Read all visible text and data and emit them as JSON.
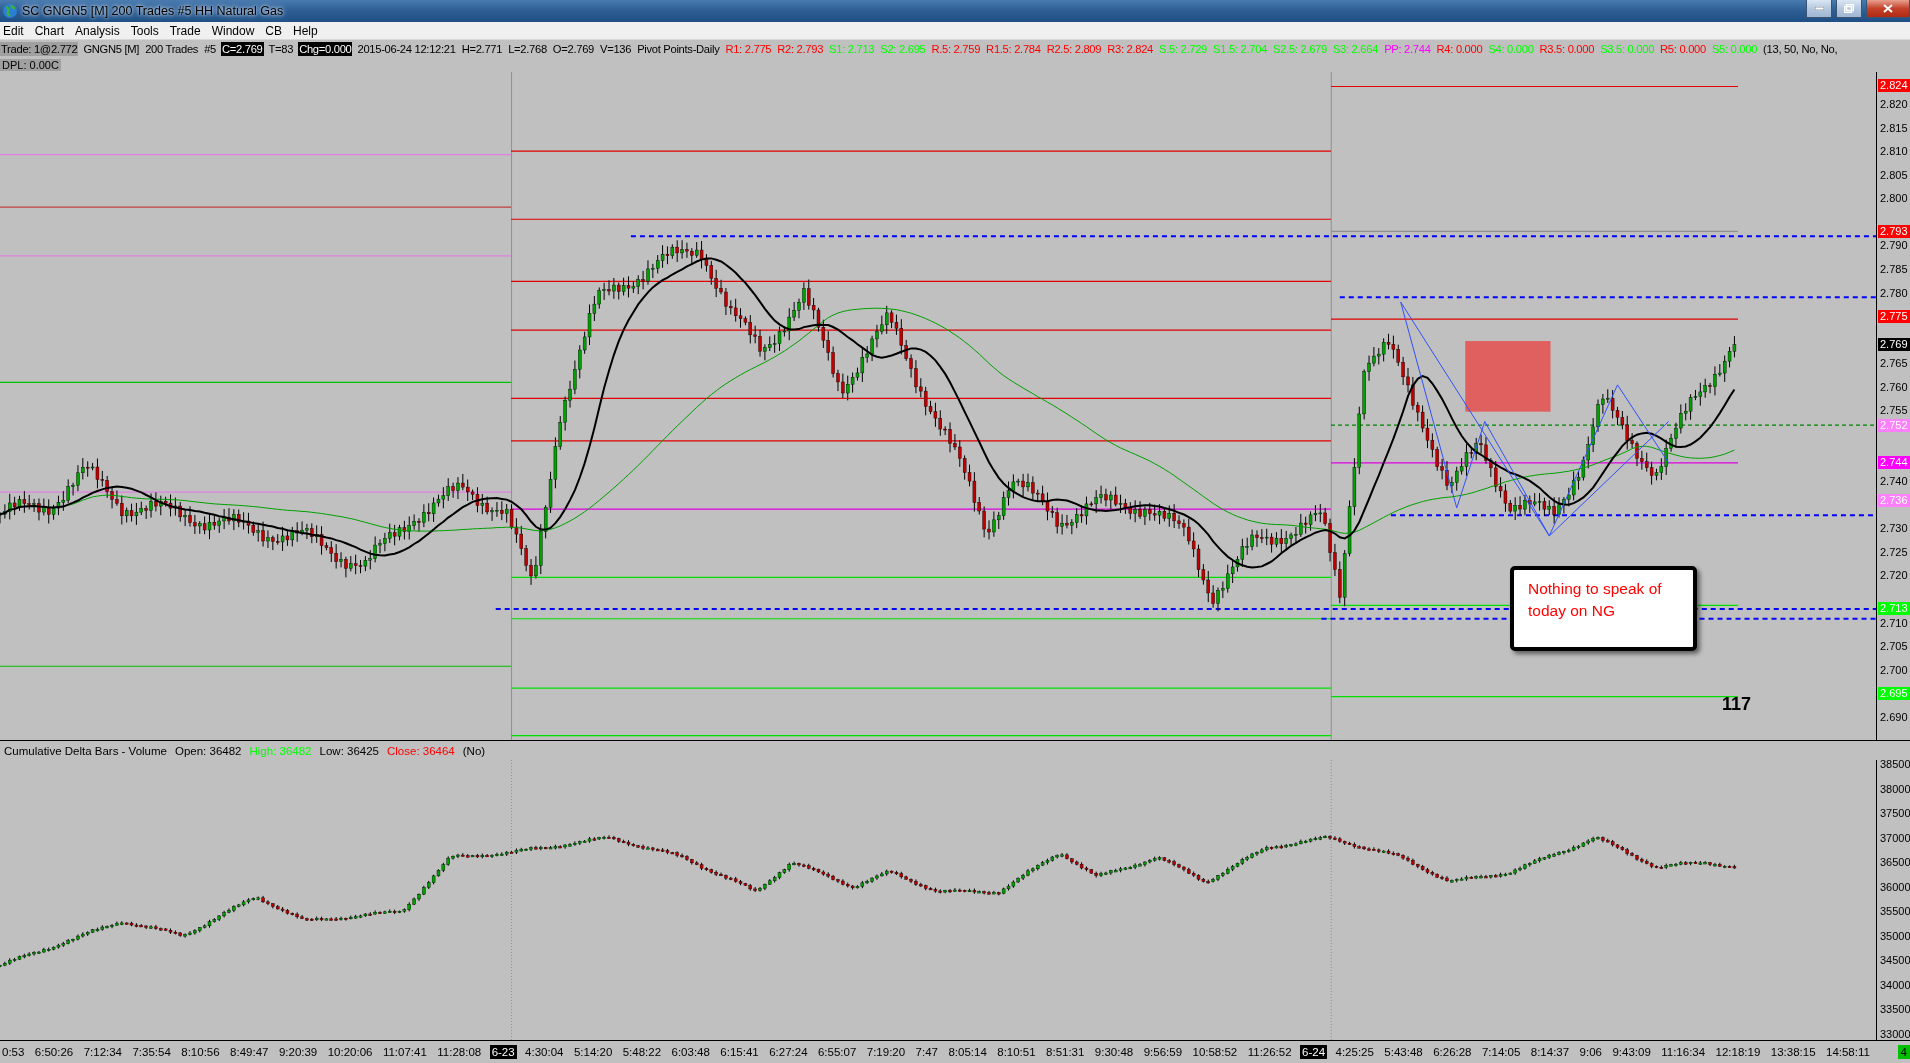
{
  "window": {
    "title": "SC GNGN5 [M]  200 Trades  #5  HH Natural Gas"
  },
  "menu": [
    "Edit",
    "Chart",
    "Analysis",
    "Tools",
    "Trade",
    "Window",
    "CB",
    "Help"
  ],
  "info_bar": [
    {
      "text": "Trade: 1@2.772",
      "kind": "shaded"
    },
    {
      "text": "GNGN5 [M]",
      "kind": "plain"
    },
    {
      "text": "200 Trades",
      "kind": "plain"
    },
    {
      "text": "#5",
      "kind": "plain"
    },
    {
      "text": "C=2.769",
      "kind": "inverse"
    },
    {
      "text": "T=83",
      "kind": "plain"
    },
    {
      "text": "Chg=0.000",
      "kind": "inverse"
    },
    {
      "text": "2015-06-24 12:12:21",
      "kind": "plain"
    },
    {
      "text": "H=2.771",
      "kind": "plain"
    },
    {
      "text": "L=2.768",
      "kind": "plain"
    },
    {
      "text": "O=2.769",
      "kind": "plain"
    },
    {
      "text": "V=136",
      "kind": "plain"
    },
    {
      "text": "Pivot Points-Daily",
      "kind": "plain"
    },
    {
      "text": "R1: 2.775",
      "kind": "plain",
      "color": "#ff0000"
    },
    {
      "text": "R2: 2.793",
      "kind": "plain",
      "color": "#ff0000"
    },
    {
      "text": "S1: 2.713",
      "kind": "plain",
      "color": "#00ff00"
    },
    {
      "text": "S2: 2.695",
      "kind": "plain",
      "color": "#00ff00"
    },
    {
      "text": "R.5: 2.759",
      "kind": "plain",
      "color": "#ff0000"
    },
    {
      "text": "R1.5: 2.784",
      "kind": "plain",
      "color": "#ff0000"
    },
    {
      "text": "R2.5: 2.809",
      "kind": "plain",
      "color": "#ff0000"
    },
    {
      "text": "R3: 2.824",
      "kind": "plain",
      "color": "#ff0000"
    },
    {
      "text": "S.5: 2.729",
      "kind": "plain",
      "color": "#00ff00"
    },
    {
      "text": "S1.5: 2.704",
      "kind": "plain",
      "color": "#00ff00"
    },
    {
      "text": "S2.5: 2.679",
      "kind": "plain",
      "color": "#00ff00"
    },
    {
      "text": "S3: 2.664",
      "kind": "plain",
      "color": "#00ff00"
    },
    {
      "text": "PP: 2.744",
      "kind": "plain",
      "color": "#ff00ff"
    },
    {
      "text": "R4: 0.000",
      "kind": "plain",
      "color": "#ff0000"
    },
    {
      "text": "S4: 0.000",
      "kind": "plain",
      "color": "#00ff00"
    },
    {
      "text": "R3.5: 0.000",
      "kind": "plain",
      "color": "#ff0000"
    },
    {
      "text": "S3.5: 0.000",
      "kind": "plain",
      "color": "#00ff00"
    },
    {
      "text": "R5: 0.000",
      "kind": "plain",
      "color": "#ff0000"
    },
    {
      "text": "S5: 0.000",
      "kind": "plain",
      "color": "#00ff00"
    },
    {
      "text": "(13, 50, No, No,",
      "kind": "plain"
    }
  ],
  "dpl": "DPL: 0.00C",
  "note": "Nothing to speak of today on NG",
  "bar_count": "117",
  "price_axis": {
    "ticks": [
      "2.820",
      "2.815",
      "2.810",
      "2.805",
      "2.800",
      "2.790",
      "2.785",
      "2.780",
      "2.765",
      "2.760",
      "2.755",
      "2.740",
      "2.730",
      "2.725",
      "2.720",
      "2.710",
      "2.705",
      "2.700",
      "2.690"
    ],
    "markers": [
      {
        "text": "2.824",
        "color": "#ff0000"
      },
      {
        "text": "2.793",
        "color": "#ff0000"
      },
      {
        "text": "2.775",
        "color": "#ff0000"
      },
      {
        "text": "2.769",
        "color": "#000000"
      },
      {
        "text": "2.752",
        "color": "#ff80ff"
      },
      {
        "text": "2.744",
        "color": "#ff00ff"
      },
      {
        "text": "2.736",
        "color": "#ff80ff"
      },
      {
        "text": "2.713",
        "color": "#00ff00"
      },
      {
        "text": "2.695",
        "color": "#00ff00"
      }
    ]
  },
  "lower_panel": {
    "header": [
      {
        "text": "Cumulative Delta Bars - Volume"
      },
      {
        "text": "Open: 36482"
      },
      {
        "text": "High: 36482",
        "color": "#00ff00"
      },
      {
        "text": "Low: 36425"
      },
      {
        "text": "Close: 36464",
        "color": "#ff0000"
      },
      {
        "text": "(No)"
      }
    ],
    "ticks": [
      "38500",
      "38000",
      "37500",
      "37000",
      "36500",
      "36000",
      "35500",
      "35000",
      "34500",
      "34000",
      "33500",
      "33000"
    ]
  },
  "time_axis": [
    {
      "text": "0:53",
      "kind": "time"
    },
    {
      "text": "6:50:26",
      "kind": "time"
    },
    {
      "text": "7:12:34",
      "kind": "time"
    },
    {
      "text": "7:35:54",
      "kind": "time"
    },
    {
      "text": "8:10:56",
      "kind": "time"
    },
    {
      "text": "8:49:47",
      "kind": "time"
    },
    {
      "text": "9:20:39",
      "kind": "time"
    },
    {
      "text": "10:20:06",
      "kind": "time"
    },
    {
      "text": "11:07:41",
      "kind": "time"
    },
    {
      "text": "11:28:08",
      "kind": "time"
    },
    {
      "text": "6-23",
      "kind": "date"
    },
    {
      "text": "4:30:04",
      "kind": "time"
    },
    {
      "text": "5:14:20",
      "kind": "time"
    },
    {
      "text": "5:48:22",
      "kind": "time"
    },
    {
      "text": "6:03:48",
      "kind": "time"
    },
    {
      "text": "6:15:41",
      "kind": "time"
    },
    {
      "text": "6:27:24",
      "kind": "time"
    },
    {
      "text": "6:55:07",
      "kind": "time"
    },
    {
      "text": "7:19:20",
      "kind": "time"
    },
    {
      "text": "7:47",
      "kind": "time"
    },
    {
      "text": "8:05:14",
      "kind": "time"
    },
    {
      "text": "8:10:51",
      "kind": "time"
    },
    {
      "text": "8:51:31",
      "kind": "time"
    },
    {
      "text": "9:30:48",
      "kind": "time"
    },
    {
      "text": "9:56:59",
      "kind": "time"
    },
    {
      "text": "10:58:52",
      "kind": "time"
    },
    {
      "text": "11:26:52",
      "kind": "time"
    },
    {
      "text": "6-24",
      "kind": "date"
    },
    {
      "text": "4:25:25",
      "kind": "time"
    },
    {
      "text": "5:43:48",
      "kind": "time"
    },
    {
      "text": "6:26:28",
      "kind": "time"
    },
    {
      "text": "7:14:05",
      "kind": "time"
    },
    {
      "text": "8:14:37",
      "kind": "time"
    },
    {
      "text": "9:06",
      "kind": "time"
    },
    {
      "text": "9:43:09",
      "kind": "time"
    },
    {
      "text": "11:16:34",
      "kind": "time"
    },
    {
      "text": "12:18:19",
      "kind": "time"
    },
    {
      "text": "13:38:15",
      "kind": "time"
    },
    {
      "text": "14:58:11",
      "kind": "time"
    }
  ],
  "corner_badge": "4"
}
